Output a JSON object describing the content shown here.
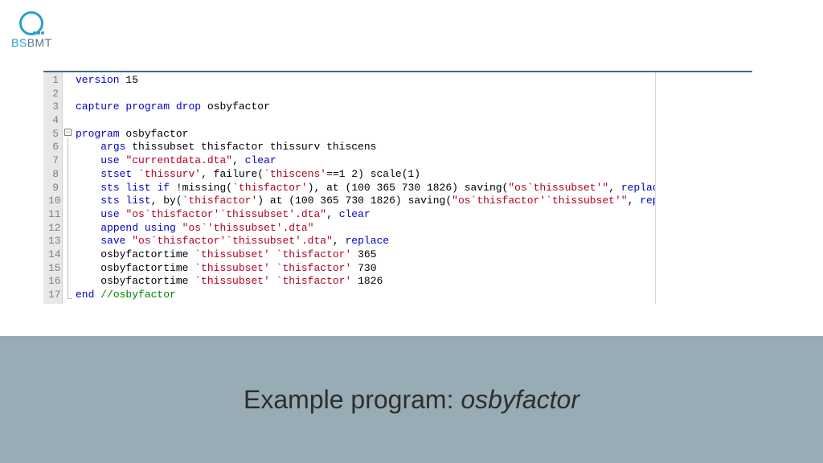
{
  "logo": {
    "bs": "BS",
    "bmt": "BMT"
  },
  "caption": {
    "prefix": "Example program: ",
    "name": "osbyfactor"
  },
  "code": {
    "line_count": 17,
    "lines": [
      [
        [
          "kw",
          "version"
        ],
        [
          "",
          " 15"
        ]
      ],
      [],
      [
        [
          "kw",
          "capture"
        ],
        [
          "",
          " "
        ],
        [
          "kw",
          "program"
        ],
        [
          "",
          " "
        ],
        [
          "kw",
          "drop"
        ],
        [
          "",
          " osbyfactor"
        ]
      ],
      [],
      [
        [
          "kw",
          "program"
        ],
        [
          "",
          " osbyfactor"
        ]
      ],
      [
        [
          "",
          "    "
        ],
        [
          "kw",
          "args"
        ],
        [
          "",
          " thissubset thisfactor thissurv thiscens"
        ]
      ],
      [
        [
          "",
          "    "
        ],
        [
          "kw",
          "use"
        ],
        [
          "",
          " "
        ],
        [
          "str",
          "\"currentdata.dta\""
        ],
        [
          "",
          ", "
        ],
        [
          "kw",
          "clear"
        ]
      ],
      [
        [
          "",
          "    "
        ],
        [
          "kw",
          "stset"
        ],
        [
          "",
          " "
        ],
        [
          "str",
          "`thissurv'"
        ],
        [
          "",
          ", failure("
        ],
        [
          "str",
          "`thiscens'"
        ],
        [
          "",
          "==1 2) scale(1)"
        ]
      ],
      [
        [
          "",
          "    "
        ],
        [
          "kw",
          "sts"
        ],
        [
          "",
          " "
        ],
        [
          "kw",
          "list"
        ],
        [
          "",
          " "
        ],
        [
          "kw",
          "if"
        ],
        [
          "",
          " !missing("
        ],
        [
          "str",
          "`thisfactor'"
        ],
        [
          "",
          "), at (100 365 730 1826) saving("
        ],
        [
          "str",
          "\"os`thissubset'\""
        ],
        [
          "",
          ", "
        ],
        [
          "kw",
          "replace"
        ],
        [
          "",
          ")"
        ]
      ],
      [
        [
          "",
          "    "
        ],
        [
          "kw",
          "sts"
        ],
        [
          "",
          " "
        ],
        [
          "kw",
          "list"
        ],
        [
          "",
          ", by("
        ],
        [
          "str",
          "`thisfactor'"
        ],
        [
          "",
          ") at (100 365 730 1826) saving("
        ],
        [
          "str",
          "\"os`thisfactor'`thissubset'\""
        ],
        [
          "",
          ", "
        ],
        [
          "kw",
          "replace"
        ],
        [
          "",
          ")"
        ]
      ],
      [
        [
          "",
          "    "
        ],
        [
          "kw",
          "use"
        ],
        [
          "",
          " "
        ],
        [
          "str",
          "\"os`thisfactor'`thissubset'.dta\""
        ],
        [
          "",
          ", "
        ],
        [
          "kw",
          "clear"
        ]
      ],
      [
        [
          "",
          "    "
        ],
        [
          "kw",
          "append"
        ],
        [
          "",
          " "
        ],
        [
          "kw",
          "using"
        ],
        [
          "",
          " "
        ],
        [
          "str",
          "\"os`'thissubset'.dta\""
        ]
      ],
      [
        [
          "",
          "    "
        ],
        [
          "kw",
          "save"
        ],
        [
          "",
          " "
        ],
        [
          "str",
          "\"os`thisfactor'`thissubset'.dta\""
        ],
        [
          "",
          ", "
        ],
        [
          "kw",
          "replace"
        ]
      ],
      [
        [
          "",
          "    osbyfactortime "
        ],
        [
          "str",
          "`thissubset'"
        ],
        [
          "",
          " "
        ],
        [
          "str",
          "`thisfactor'"
        ],
        [
          "",
          " 365"
        ]
      ],
      [
        [
          "",
          "    osbyfactortime "
        ],
        [
          "str",
          "`thissubset'"
        ],
        [
          "",
          " "
        ],
        [
          "str",
          "`thisfactor'"
        ],
        [
          "",
          " 730"
        ]
      ],
      [
        [
          "",
          "    osbyfactortime "
        ],
        [
          "str",
          "`thissubset'"
        ],
        [
          "",
          " "
        ],
        [
          "str",
          "`thisfactor'"
        ],
        [
          "",
          " 1826"
        ]
      ],
      [
        [
          "kw",
          "end"
        ],
        [
          "",
          " "
        ],
        [
          "grn",
          "//osbyfactor"
        ]
      ]
    ]
  }
}
